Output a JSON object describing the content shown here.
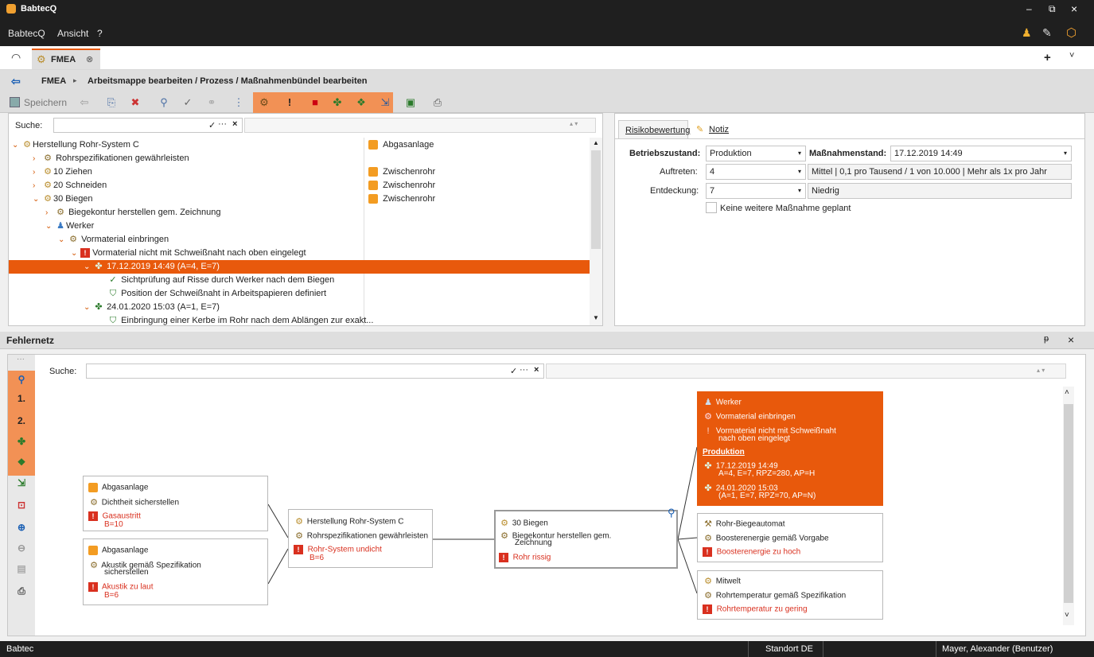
{
  "window": {
    "title": "BabtecQ",
    "controls": [
      "–",
      "⧉",
      "×"
    ]
  },
  "menu": {
    "items": [
      "BabtecQ",
      "Ansicht",
      "?"
    ]
  },
  "tabs": [
    {
      "label": "FMEA"
    }
  ],
  "tab_actions": {
    "add": "+",
    "dropdown": "˅"
  },
  "breadcrumb": {
    "root": "FMEA",
    "path": "Arbeitsmappe bearbeiten / Prozess / Maßnahmenbündel bearbeiten"
  },
  "toolbar": {
    "save_label": "Speichern"
  },
  "tree_panel": {
    "search_label": "Suche:",
    "search_value": "",
    "rows": [
      {
        "text": "Herstellung Rohr-System C",
        "right": "Abgasanlage"
      },
      {
        "text": "Rohrspezifikationen gewährleisten",
        "right": ""
      },
      {
        "text": "10 Ziehen",
        "right": "Zwischenrohr"
      },
      {
        "text": "20 Schneiden",
        "right": "Zwischenrohr"
      },
      {
        "text": "30 Biegen",
        "right": "Zwischenrohr"
      },
      {
        "text": "Biegekontur herstellen gem. Zeichnung",
        "right": ""
      },
      {
        "text": "Werker",
        "right": ""
      },
      {
        "text": "Vormaterial einbringen",
        "right": ""
      },
      {
        "text": "Vormaterial nicht mit Schweißnaht nach oben eingelegt",
        "right": ""
      },
      {
        "text": "17.12.2019 14:49 (A=4, E=7)",
        "right": ""
      },
      {
        "text": "Sichtprüfung auf Risse durch Werker nach dem Biegen",
        "right": ""
      },
      {
        "text": "Position der Schweißnaht in Arbeitspapieren definiert",
        "right": ""
      },
      {
        "text": "24.01.2020 15:03 (A=1, E=7)",
        "right": ""
      },
      {
        "text": "Einbringung einer Kerbe im Rohr nach dem Ablängen zur exakt...",
        "right": ""
      }
    ]
  },
  "risk_panel": {
    "tabs": [
      "Risikobewertung",
      "Notiz"
    ],
    "betriebszustand_label": "Betriebszustand:",
    "betriebszustand_value": "Produktion",
    "massnahmenstand_label": "Maßnahmenstand:",
    "massnahmenstand_value": "17.12.2019 14:49",
    "auftreten_label": "Auftreten:",
    "auftreten_value": "4",
    "auftreten_desc": "Mittel | 0,1 pro Tausend / 1 von 10.000 | Mehr als 1x pro Jahr",
    "entdeckung_label": "Entdeckung:",
    "entdeckung_value": "7",
    "entdeckung_desc": "Niedrig",
    "checkbox_label": "Keine weitere Maßnahme geplant"
  },
  "fehlernetz": {
    "title": "Fehlernetz",
    "search_label": "Suche:",
    "side_labels": [
      "1.",
      "2."
    ],
    "nodes": {
      "left1": {
        "a": "Abgasanlage",
        "b": "Dichtheit sicherstellen",
        "c": "Gasaustritt",
        "d": "B=10"
      },
      "left2": {
        "a": "Abgasanlage",
        "b": "Akustik gemäß Spezifikation",
        "b2": "sicherstellen",
        "c": "Akustik zu laut",
        "d": "B=6"
      },
      "mid": {
        "a": "Herstellung Rohr-System C",
        "b": "Rohrspezifikationen gewährleisten",
        "c": "Rohr-System undicht",
        "d": "B=6"
      },
      "center": {
        "a": "30 Biegen",
        "b": "Biegekontur herstellen gem.",
        "b2": "Zeichnung",
        "c": "Rohr rissig"
      },
      "focus": {
        "a": "Werker",
        "b": "Vormaterial einbringen",
        "c": "Vormaterial nicht mit Schweißnaht",
        "c2": "nach oben eingelegt",
        "section": "Produktion",
        "m1a": "17.12.2019 14:49",
        "m1b": "A=4, E=7, RPZ=280, AP=H",
        "m2a": "24.01.2020 15:03",
        "m2b": "(A=1, E=7, RPZ=70, AP=N)"
      },
      "right2": {
        "a": "Rohr-Biegeautomat",
        "b": "Boosterenergie gemäß Vorgabe",
        "c": "Boosterenergie zu hoch"
      },
      "right3": {
        "a": "Mitwelt",
        "b": "Rohrtemperatur gemäß Spezifikation",
        "c": "Rohrtemperatur zu gering"
      }
    }
  },
  "status": {
    "left": "Babtec",
    "location": "Standort DE",
    "user": "Mayer, Alexander (Benutzer)"
  },
  "colors": {
    "accent": "#e8590c",
    "dark": "#1f1f1f",
    "error": "#d9301f"
  }
}
